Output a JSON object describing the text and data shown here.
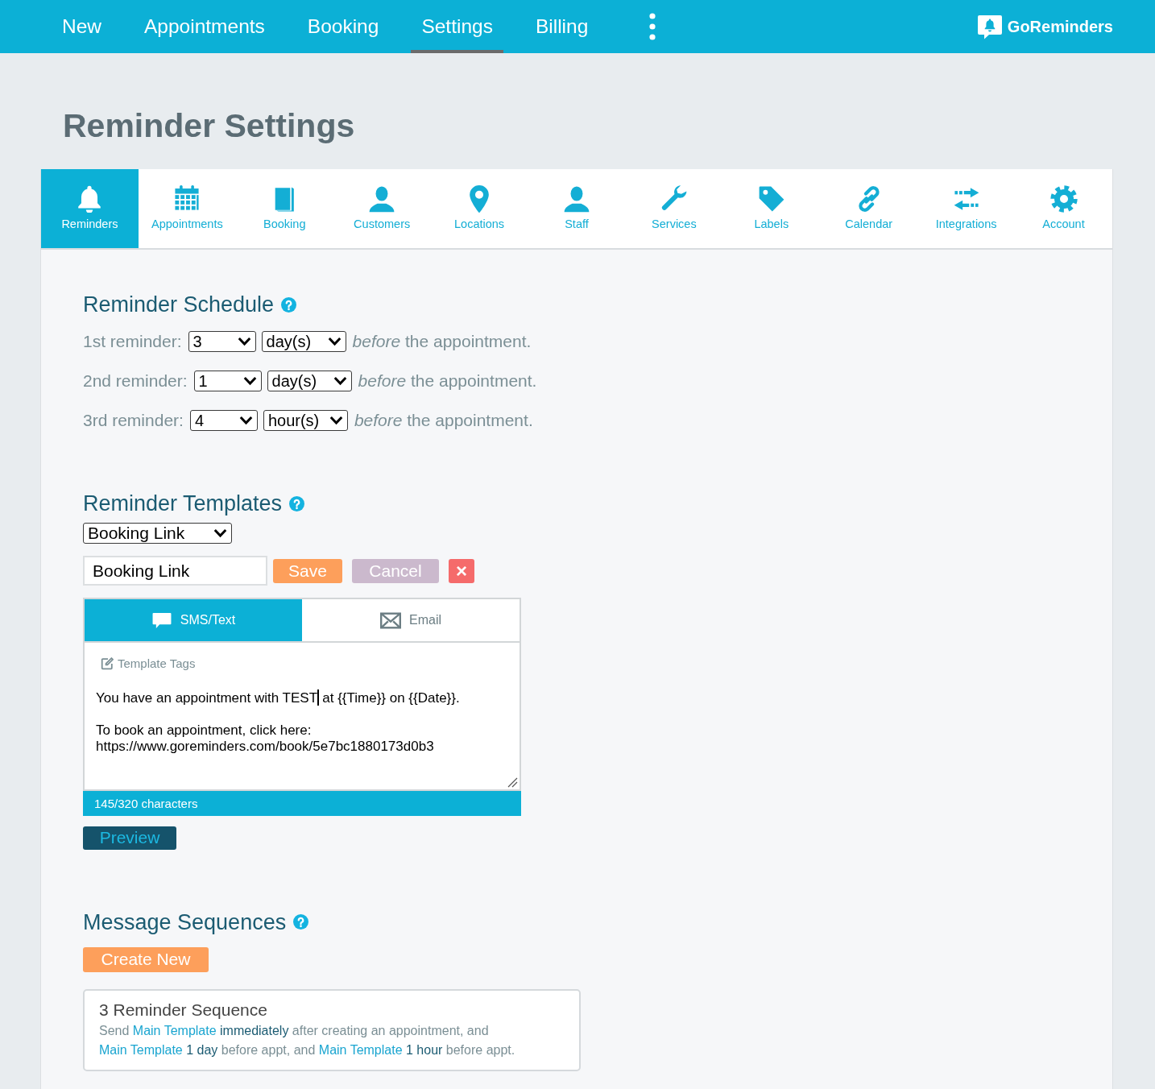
{
  "top_nav": {
    "items": [
      {
        "label": "New",
        "selected": false
      },
      {
        "label": "Appointments",
        "selected": false
      },
      {
        "label": "Booking",
        "selected": false
      },
      {
        "label": "Settings",
        "selected": true
      },
      {
        "label": "Billing",
        "selected": false
      }
    ],
    "brand": "GoReminders"
  },
  "page_title": "Reminder Settings",
  "settings_tabs": [
    {
      "label": "Reminders",
      "selected": true
    },
    {
      "label": "Appointments",
      "selected": false
    },
    {
      "label": "Booking",
      "selected": false
    },
    {
      "label": "Customers",
      "selected": false
    },
    {
      "label": "Locations",
      "selected": false
    },
    {
      "label": "Staff",
      "selected": false
    },
    {
      "label": "Services",
      "selected": false
    },
    {
      "label": "Labels",
      "selected": false
    },
    {
      "label": "Calendar",
      "selected": false
    },
    {
      "label": "Integrations",
      "selected": false
    },
    {
      "label": "Account",
      "selected": false
    }
  ],
  "reminder_schedule": {
    "title": "Reminder Schedule",
    "rows": [
      {
        "label": "1st reminder:",
        "amount": "3",
        "unit": "day(s)",
        "note": "*before* the appointment."
      },
      {
        "label": "2nd reminder:",
        "amount": "1",
        "unit": "day(s)",
        "note": "*before* the appointment."
      },
      {
        "label": "3rd reminder:",
        "amount": "4",
        "unit": "hour(s)",
        "note": "*before* the appointment."
      }
    ]
  },
  "reminder_templates": {
    "title": "Reminder Templates",
    "template_select": "Booking Link",
    "name_field": "Booking Link",
    "save_button": "Save",
    "cancel_button": "Cancel",
    "delete_button": "×",
    "editor": {
      "tabs": [
        {
          "label": "SMS/Text",
          "selected": true
        },
        {
          "label": "Email",
          "selected": false
        }
      ],
      "template_tags": "Template Tags",
      "message_before_cursor": "You have an appointment with TEST",
      "message_after_cursor": " at {{Time}} on {{Date}}.\n\nTo book an appointment, click here:\nhttps://www.goreminders.com/book/5e7bc1880173d0b3",
      "counter": "145/320 characters"
    },
    "preview_button": "Preview"
  },
  "message_sequences": {
    "title": "Message Sequences",
    "create_button": "Create New",
    "sequences": [
      {
        "title": "3 Reminder Sequence",
        "description": [
          {
            "kind": "plain",
            "text": "Send "
          },
          {
            "kind": "link",
            "text": "Main Template"
          },
          {
            "kind": "value",
            "text": " immediately"
          },
          {
            "kind": "plain",
            "text": " after creating an appointment, and "
          },
          {
            "kind": "link",
            "text": "Main Template"
          },
          {
            "kind": "value",
            "text": " 1 day"
          },
          {
            "kind": "plain",
            "text": " before appt, and "
          },
          {
            "kind": "link",
            "text": "Main Template"
          },
          {
            "kind": "value",
            "text": " 1 hour"
          },
          {
            "kind": "plain",
            "text": " before appt."
          }
        ]
      }
    ]
  }
}
